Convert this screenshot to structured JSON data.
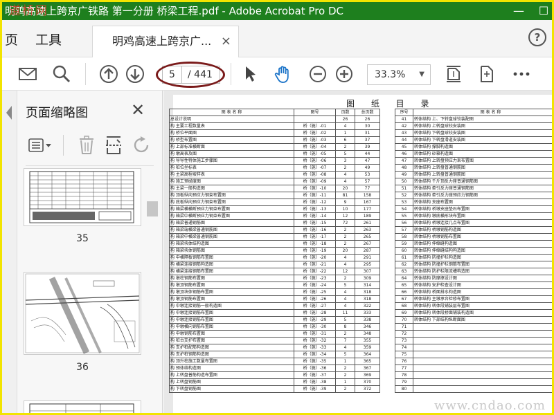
{
  "window": {
    "title": "明鸡高速上跨京广铁路 第一分册 桥梁工程.pdf - Adobe Acrobat Pro DC",
    "logo_text": "道桥网",
    "controls": [
      "—",
      "☐"
    ]
  },
  "menu": {
    "home_partial": "页",
    "tools": "工具"
  },
  "tab": {
    "label": "明鸡高速上跨京广...",
    "close": "×"
  },
  "toolbar": {
    "page_current": "5",
    "page_total": "/ 441",
    "zoom": "33.3%",
    "icons": [
      "mail-icon",
      "search-icon",
      "page-up-icon",
      "page-down-icon",
      "select-arrow-icon",
      "hand-tool-icon",
      "zoom-out-icon",
      "zoom-in-icon",
      "fit-page-icon",
      "rotate-view-icon",
      "more-icon"
    ]
  },
  "sidebar": {
    "title": "页面缩略图",
    "thumbnails": [
      {
        "label": "35"
      },
      {
        "label": "36"
      }
    ]
  },
  "document": {
    "heading": "图 纸 目 录",
    "left_headers": [
      "图 表 名 称",
      "图号",
      "页数",
      "总页数"
    ],
    "right_headers": [
      "序号",
      "图 表 名 称"
    ],
    "left_rows": [
      [
        "总设计说明",
        "",
        "26",
        "26"
      ],
      [
        "构 主要工程数量表",
        "桥（施）-01",
        "4",
        "30"
      ],
      [
        "构 桥位平面图",
        "桥（施）-02",
        "1",
        "31"
      ],
      [
        "构 桥型布置图",
        "桥（施）-03",
        "6",
        "37"
      ],
      [
        "构 上部标准横断面",
        "桥（施）-04",
        "2",
        "39"
      ],
      [
        "构 墩高表及图",
        "桥（施）-05",
        "5",
        "44"
      ],
      [
        "构 导导性特体施工步骤图",
        "桥（施）-06",
        "3",
        "47"
      ],
      [
        "构 桩位坐标表",
        "桥（施）-07",
        "2",
        "49"
      ],
      [
        "构 主梁高程坡样表",
        "桥（施）-08",
        "4",
        "53"
      ],
      [
        "构 施工预抛度图",
        "桥（施）-09",
        "4",
        "57"
      ],
      [
        "构 主梁一般构造图",
        "桥（施）-10",
        "20",
        "77"
      ],
      [
        "构 顶板纵向预应力钢束布置图",
        "桥（施）-11",
        "81",
        "158"
      ],
      [
        "构 底板纵向预应力钢束布置图",
        "桥（施）-12",
        "9",
        "167"
      ],
      [
        "构 箱梁横横断预应力钢束布置图",
        "桥（施）-13",
        "10",
        "177"
      ],
      [
        "构 箱梁中横断预应力钢束布置图",
        "桥（施）-14",
        "12",
        "189"
      ],
      [
        "构 箱梁普通钢筋图",
        "桥（施）-15",
        "72",
        "261"
      ],
      [
        "构 箱梁端横梁普通钢筋图",
        "桥（施）-16",
        "2",
        "263"
      ],
      [
        "构 箱梁中横梁普通钢筋图",
        "桥（施）-17",
        "2",
        "265"
      ],
      [
        "构 箱梁块体结构造图",
        "桥（施）-18",
        "2",
        "267"
      ],
      [
        "构 箱梁块体钢筋图",
        "桥（施）-19",
        "20",
        "287"
      ],
      [
        "构 中横隔板钢筋布置图",
        "桥（施）-20",
        "4",
        "291"
      ],
      [
        "构 横梁连接钢筋构造图",
        "桥（施）-21",
        "4",
        "295"
      ],
      [
        "构 横梁连接钢筋布置图",
        "桥（施）-22",
        "12",
        "307"
      ],
      [
        "构 墩柱钢筋布置图",
        "桥（施）-23",
        "2",
        "309"
      ],
      [
        "构 墩顶钢筋布置图",
        "桥（施）-24",
        "5",
        "314"
      ],
      [
        "构 墩顶块体钢筋布置图",
        "桥（施）-25",
        "4",
        "318"
      ],
      [
        "构 墩顶钢筋布置图",
        "桥（施）-26",
        "4",
        "318"
      ],
      [
        "构 中墩连接钢筋一般构造图",
        "桥（施）-27",
        "4",
        "322"
      ],
      [
        "构 中墩连接钢筋布置图",
        "桥（施）-28",
        "11",
        "333"
      ],
      [
        "构 中墩连接钢筋布置图",
        "桥（施）-29",
        "5",
        "338"
      ],
      [
        "构 中墩横向钢筋布置图",
        "桥（施）-30",
        "8",
        "346"
      ],
      [
        "构 中墩钢筋布置图",
        "桥（施）-31",
        "2",
        "348"
      ],
      [
        "构 桩台支护布置图",
        "桥（施）-32",
        "7",
        "355"
      ],
      [
        "构 支护桩配筋构造图",
        "桥（施）-33",
        "4",
        "359"
      ],
      [
        "构 支护桩钢筋构造图",
        "桥（施）-34",
        "5",
        "364"
      ],
      [
        "构 顶升柱施工数量布置图",
        "桥（施）-35",
        "1",
        "365"
      ],
      [
        "构 预体结构造图",
        "桥（施）-36",
        "2",
        "367"
      ],
      [
        "构 上转盘普筋构造布置图",
        "桥（施）-37",
        "2",
        "369"
      ],
      [
        "构 上转盘钢筋图",
        "桥（施）-38",
        "1",
        "370"
      ],
      [
        "构 下转盘钢筋图",
        "桥（施）-39",
        "2",
        "372"
      ]
    ],
    "right_rows": [
      [
        "41",
        "转体结构 上、下转盘球铰装配图"
      ],
      [
        "42",
        "转体结构 上转盘球铰安装图"
      ],
      [
        "43",
        "转体结构 下转盘球铰安装图"
      ],
      [
        "44",
        "转体结构 下转盘滑道安装图"
      ],
      [
        "45",
        "转体结构 撑脚构造图"
      ],
      [
        "46",
        "转体结构 砂箱构造图"
      ],
      [
        "47",
        "转体结构 上转盘预应力束布置图"
      ],
      [
        "48",
        "转体结构 上转盘普通钢筋图"
      ],
      [
        "49",
        "转体结构 上转盘普通钢筋图"
      ],
      [
        "50",
        "转体结构 千斤顶反力座普通钢筋图"
      ],
      [
        "51",
        "转体结构 牵引反力座普通钢筋图"
      ],
      [
        "52",
        "转体结构 牵引反力座预应力钢筋图"
      ],
      [
        "53",
        "转体结构 支座布置图"
      ],
      [
        "54",
        "转体结构 桥墩支座垫石布置图"
      ],
      [
        "55",
        "转体结构 墩底横形块布置图"
      ],
      [
        "56",
        "转体结构 桥墩连接几点布置图"
      ],
      [
        "57",
        "转体结构 桥墩钢筋构造图"
      ],
      [
        "58",
        "转体结构 桥墩钢筋布置图"
      ],
      [
        "59",
        "转体结构 伸缩缝构造图"
      ],
      [
        "60",
        "转体结构 伸缩缝结构构造图"
      ],
      [
        "61",
        "转体结构 防撞护栏构造图"
      ],
      [
        "62",
        "转体结构 防撞护栏钢筋布置图"
      ],
      [
        "63",
        "转体结构 防护栏限流槽构造图"
      ],
      [
        "64",
        "转体结构 防摩擦设计图"
      ],
      [
        "65",
        "转体结构 安护检查设计图"
      ],
      [
        "66",
        "转体结构 桥面排水构造图"
      ],
      [
        "67",
        "转体结构 主墩承台检修布置图"
      ],
      [
        "68",
        "转体结构 转体段铺装层布置图"
      ],
      [
        "69",
        "转体结构 转体段桥面铺装构造图"
      ],
      [
        "70",
        "转体结构 下部结构纵断面图"
      ],
      [
        "71",
        ""
      ],
      [
        "72",
        ""
      ],
      [
        "73",
        ""
      ],
      [
        "74",
        ""
      ],
      [
        "75",
        ""
      ],
      [
        "76",
        ""
      ],
      [
        "77",
        ""
      ],
      [
        "78",
        ""
      ],
      [
        "79",
        ""
      ],
      [
        "80",
        ""
      ]
    ],
    "watermark": "www.cndao.com"
  }
}
